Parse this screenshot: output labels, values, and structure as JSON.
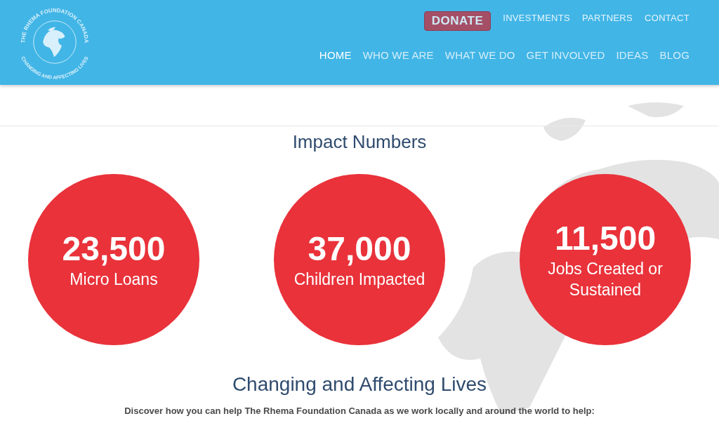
{
  "logo": {
    "top_text": "THE RHEMA FOUNDATION CANADA",
    "bottom_text": "CHANGING AND AFFECTING LIVES"
  },
  "donate_button": "DONATE",
  "top_links": [
    "INVESTMENTS",
    "PARTNERS",
    "CONTACT"
  ],
  "nav": [
    {
      "label": "HOME",
      "selected": true
    },
    {
      "label": "WHO WE ARE",
      "selected": false
    },
    {
      "label": "WHAT WE DO",
      "selected": false
    },
    {
      "label": "GET INVOLVED",
      "selected": false
    },
    {
      "label": "IDEAS",
      "selected": false
    },
    {
      "label": "BLOG",
      "selected": false
    }
  ],
  "impact": {
    "title": "Impact Numbers",
    "stats": [
      {
        "number": "23,500",
        "label": "Micro Loans"
      },
      {
        "number": "37,000",
        "label": "Children Impacted"
      },
      {
        "number": "11,500",
        "label": "Jobs Created or Sustained"
      }
    ]
  },
  "lives": {
    "title": "Changing and Affecting Lives",
    "text": "Discover how you can help The Rhema Foundation Canada as we work locally and around the world to help:"
  }
}
